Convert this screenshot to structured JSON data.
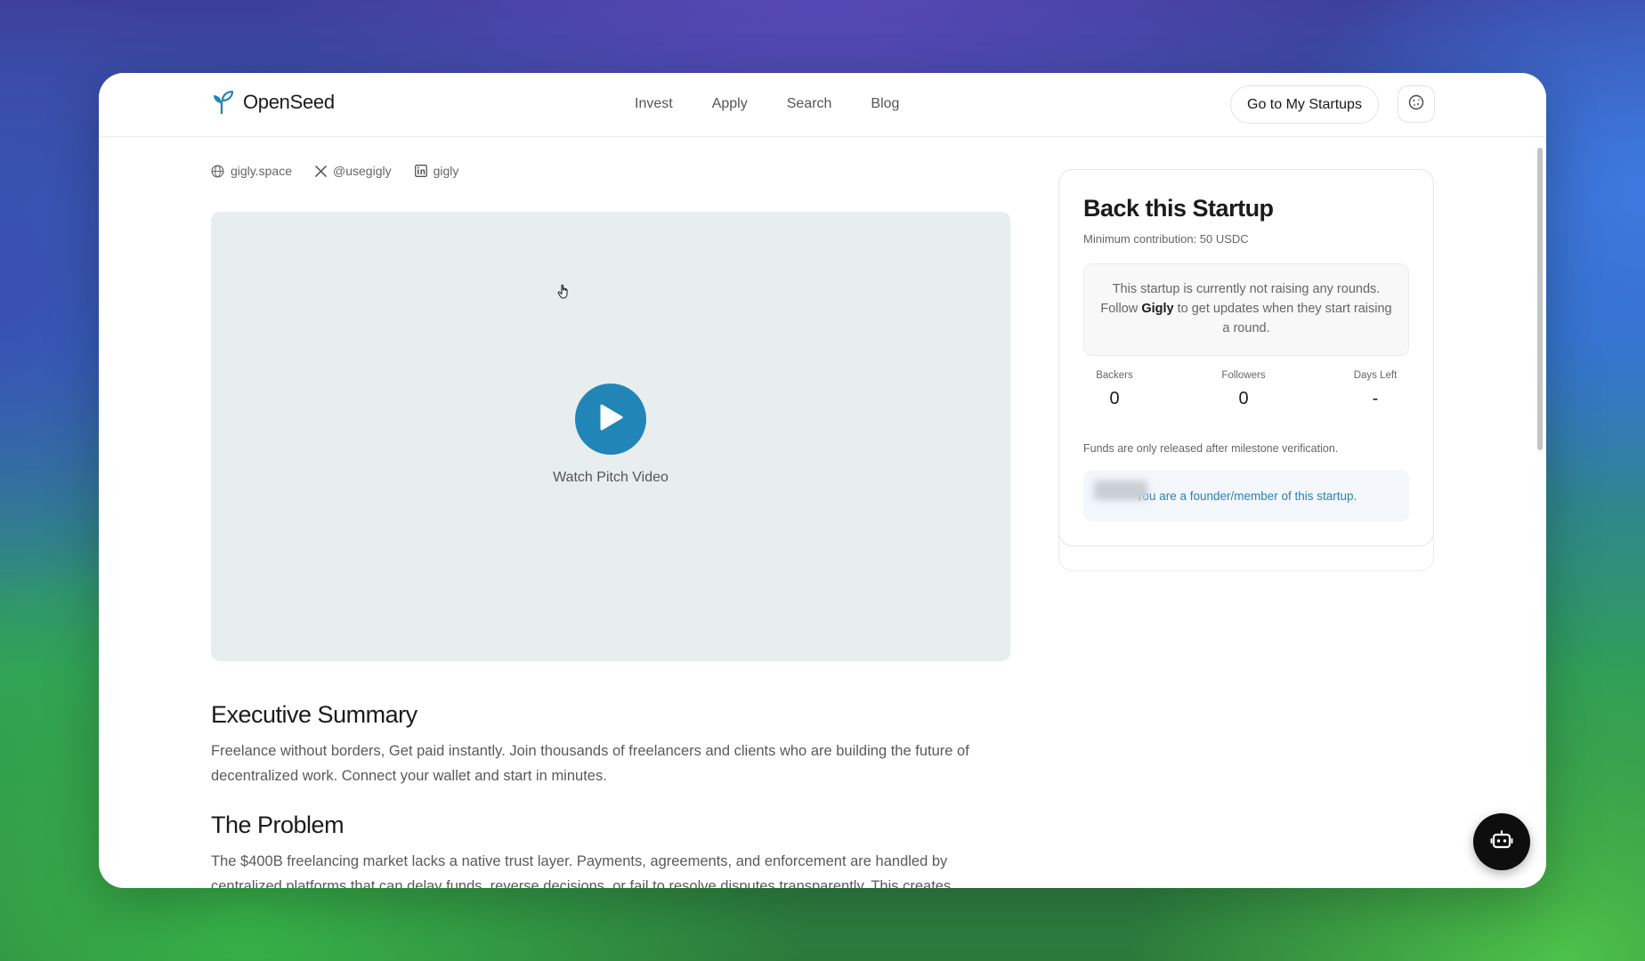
{
  "header": {
    "logo_text": "OpenSeed",
    "nav": [
      "Invest",
      "Apply",
      "Search",
      "Blog"
    ],
    "cta_label": "Go to My Startups"
  },
  "links": {
    "website": "gigly.space",
    "twitter": "@usegigly",
    "linkedin": "gigly"
  },
  "video": {
    "label": "Watch Pitch Video"
  },
  "sections": {
    "executive_summary": {
      "title": "Executive Summary",
      "text": "Freelance without borders, Get paid instantly. Join thousands of freelancers and clients who are building the future of decentralized work. Connect your wallet and start in minutes."
    },
    "problem": {
      "title": "The Problem",
      "text": "The $400B freelancing market lacks a native trust layer. Payments, agreements, and enforcement are handled by centralized platforms that can delay funds, reverse decisions, or fail to resolve disputes transparently. This creates"
    }
  },
  "sidebar": {
    "title": "Back this Startup",
    "min_contribution": "Minimum contribution: 50 USDC",
    "notice": {
      "before": "This startup is currently not raising any rounds. Follow ",
      "name": "Gigly",
      "after": " to get updates when they start raising a round."
    },
    "stats": {
      "backers_label": "Backers",
      "backers_value": "0",
      "followers_label": "Followers",
      "followers_value": "0",
      "days_label": "Days Left",
      "days_value": "-"
    },
    "funds_note": "Funds are only released after milestone verification.",
    "founder_note": "You are a founder/member of this startup."
  },
  "colors": {
    "accent": "#2185b8",
    "link_blue": "#2b82b5"
  },
  "icons": {
    "logo": "sprout-icon",
    "theme_toggle": "cookie-icon",
    "website": "globe-icon",
    "twitter": "x-icon",
    "linkedin": "linkedin-icon",
    "play": "play-icon",
    "chat": "robot-icon"
  }
}
